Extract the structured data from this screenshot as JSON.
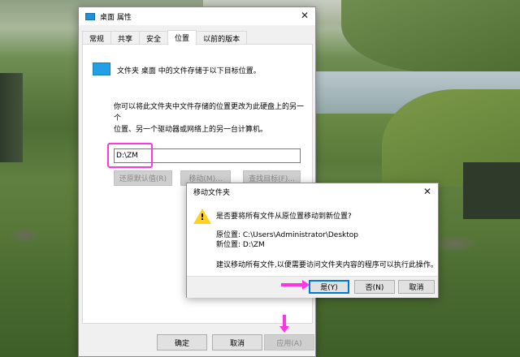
{
  "properties_dialog": {
    "title": "桌面 属性",
    "close_glyph": "✕",
    "tabs": [
      {
        "label": "常规",
        "active": false
      },
      {
        "label": "共享",
        "active": false
      },
      {
        "label": "安全",
        "active": false
      },
      {
        "label": "位置",
        "active": true
      },
      {
        "label": "以前的版本",
        "active": false
      }
    ],
    "folder_description": "文件夹 桌面 中的文件存储于以下目标位置。",
    "move_description_line1": "你可以将此文件夹中文件存储的位置更改为此硬盘上的另一个",
    "move_description_line2": "位置、另一个驱动器或网络上的另一台计算机。",
    "path_value": "D:\\ZM",
    "buttons": {
      "restore_default": "还原默认值(R)",
      "move": "移动(M)...",
      "find_target": "查找目标(F)..."
    },
    "footer": {
      "ok": "确定",
      "cancel": "取消",
      "apply": "应用(A)"
    }
  },
  "confirm_dialog": {
    "title": "移动文件夹",
    "close_glyph": "✕",
    "question": "是否要将所有文件从原位置移动到新位置?",
    "source_label_line": "原位置: C:\\Users\\Administrator\\Desktop",
    "dest_label_line": "新位置: D:\\ZM",
    "note": "建议移动所有文件,以便需要访问文件夹内容的程序可以执行此操作。",
    "buttons": {
      "yes": "是(Y)",
      "no": "否(N)",
      "cancel": "取消"
    }
  },
  "colors": {
    "annotation": "#ff35e1",
    "accent": "#0078d7",
    "warning": "#ffd21f"
  }
}
